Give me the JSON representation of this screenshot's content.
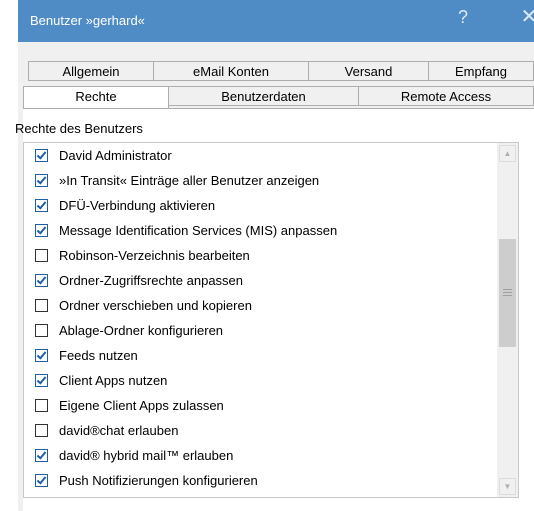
{
  "window": {
    "title": "Benutzer »gerhard«",
    "help_glyph": "?",
    "close_glyph": "✕"
  },
  "tabs_row1": [
    {
      "label": "Allgemein"
    },
    {
      "label": "eMail Konten"
    },
    {
      "label": "Versand"
    },
    {
      "label": "Empfang"
    }
  ],
  "tabs_row2": [
    {
      "label": "Rechte",
      "active": true
    },
    {
      "label": "Benutzerdaten"
    },
    {
      "label": "Remote Access"
    }
  ],
  "rights": {
    "group_label": "Rechte des Benutzers",
    "items": [
      {
        "label": "David Administrator",
        "checked": true
      },
      {
        "label": "»In Transit« Einträge aller Benutzer anzeigen",
        "checked": true
      },
      {
        "label": "DFÜ-Verbindung aktivieren",
        "checked": true
      },
      {
        "label": "Message Identification Services (MIS) anpassen",
        "checked": true
      },
      {
        "label": "Robinson-Verzeichnis bearbeiten",
        "checked": false
      },
      {
        "label": "Ordner-Zugriffsrechte anpassen",
        "checked": true
      },
      {
        "label": "Ordner verschieben und kopieren",
        "checked": false
      },
      {
        "label": "Ablage-Ordner konfigurieren",
        "checked": false
      },
      {
        "label": "Feeds nutzen",
        "checked": true
      },
      {
        "label": "Client Apps nutzen",
        "checked": true
      },
      {
        "label": "Eigene Client Apps zulassen",
        "checked": false
      },
      {
        "label": "david®chat erlauben",
        "checked": false
      },
      {
        "label": "david® hybrid mail™ erlauben",
        "checked": true
      },
      {
        "label": "Push Notifizierungen konfigurieren",
        "checked": true
      }
    ]
  },
  "scrollbar": {
    "up_glyph": "▲",
    "down_glyph": "▼"
  },
  "colors": {
    "titlebar": "#4f8cc5",
    "checkmark": "#1c5fa8"
  }
}
